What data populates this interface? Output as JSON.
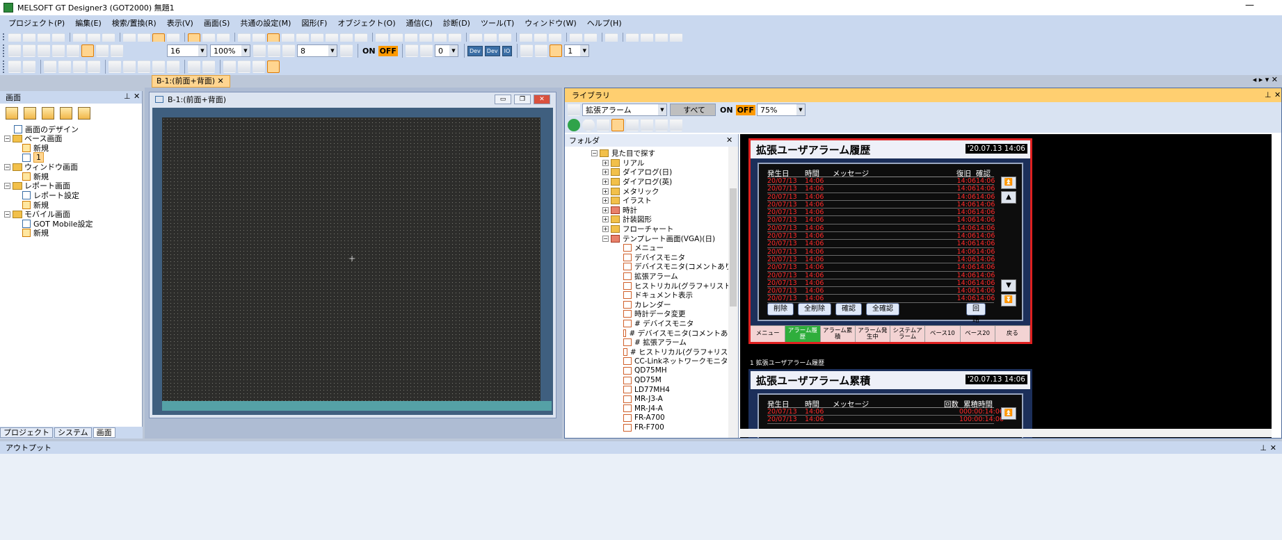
{
  "window": {
    "title": "MELSOFT GT Designer3 (GOT2000) 無題1"
  },
  "menu": [
    "プロジェクト(P)",
    "編集(E)",
    "検索/置換(R)",
    "表示(V)",
    "画面(S)",
    "共通の設定(M)",
    "図形(F)",
    "オブジェクト(O)",
    "通信(C)",
    "診断(D)",
    "ツール(T)",
    "ウィンドウ(W)",
    "ヘルプ(H)"
  ],
  "toolbar": {
    "font_size": "16",
    "zoom": "100%",
    "grid": "8",
    "on_label": "ON",
    "off_label": "OFF",
    "station": "0",
    "dev_label": "Dev",
    "io_label": "IO",
    "layer": "1"
  },
  "screen_panel": {
    "title": "画面",
    "tree": [
      {
        "label": "画面のデザイン",
        "level": 1,
        "kind": "item"
      },
      {
        "label": "ベース画面",
        "level": 0,
        "kind": "folder"
      },
      {
        "label": "新規",
        "level": 2,
        "kind": "new"
      },
      {
        "label": "1",
        "level": 2,
        "kind": "page-selected"
      },
      {
        "label": "ウィンドウ画面",
        "level": 0,
        "kind": "folder"
      },
      {
        "label": "新規",
        "level": 2,
        "kind": "new"
      },
      {
        "label": "レポート画面",
        "level": 0,
        "kind": "folder"
      },
      {
        "label": "レポート設定",
        "level": 2,
        "kind": "item"
      },
      {
        "label": "新規",
        "level": 2,
        "kind": "new"
      },
      {
        "label": "モバイル画面",
        "level": 0,
        "kind": "folder"
      },
      {
        "label": "GOT Mobile設定",
        "level": 2,
        "kind": "item"
      },
      {
        "label": "新規",
        "level": 2,
        "kind": "new"
      }
    ],
    "tabs": [
      "プロジェクト",
      "システム",
      "画面"
    ]
  },
  "editor": {
    "tab_label": "B-1:(前面+背面)",
    "window_title": "B-1:(前面+背面)"
  },
  "library": {
    "title": "ライブラリ",
    "category": "拡張アラーム",
    "filter": "すべて",
    "on_label": "ON",
    "off_label": "OFF",
    "zoom": "75%",
    "folder_header": "フォルダ",
    "folder_tree": [
      {
        "label": "見た目で探す",
        "level": 0,
        "kind": "folder-open"
      },
      {
        "label": "リアル",
        "level": 1,
        "kind": "folder"
      },
      {
        "label": "ダイアログ(日)",
        "level": 1,
        "kind": "folder"
      },
      {
        "label": "ダイアログ(英)",
        "level": 1,
        "kind": "folder"
      },
      {
        "label": "メタリック",
        "level": 1,
        "kind": "folder"
      },
      {
        "label": "イラスト",
        "level": 1,
        "kind": "folder"
      },
      {
        "label": "時計",
        "level": 1,
        "kind": "folder-red"
      },
      {
        "label": "計装図形",
        "level": 1,
        "kind": "folder"
      },
      {
        "label": "フローチャート",
        "level": 1,
        "kind": "folder"
      },
      {
        "label": "テンプレート画面(VGA)(日)",
        "level": 1,
        "kind": "folder-open-red"
      },
      {
        "label": "メニュー",
        "level": 2,
        "kind": "item"
      },
      {
        "label": "デバイスモニタ",
        "level": 2,
        "kind": "item"
      },
      {
        "label": "デバイスモニタ(コメントあり)",
        "level": 2,
        "kind": "item"
      },
      {
        "label": "拡張アラーム",
        "level": 2,
        "kind": "item"
      },
      {
        "label": "ヒストリカル(グラフ+リスト)",
        "level": 2,
        "kind": "item"
      },
      {
        "label": "ドキュメント表示",
        "level": 2,
        "kind": "item"
      },
      {
        "label": "カレンダー",
        "level": 2,
        "kind": "item"
      },
      {
        "label": "時計データ変更",
        "level": 2,
        "kind": "item"
      },
      {
        "label": "# デバイスモニタ",
        "level": 2,
        "kind": "item"
      },
      {
        "label": "# デバイスモニタ(コメントあり)",
        "level": 2,
        "kind": "item"
      },
      {
        "label": "# 拡張アラーム",
        "level": 2,
        "kind": "item"
      },
      {
        "label": "# ヒストリカル(グラフ+リスト)",
        "level": 2,
        "kind": "item"
      },
      {
        "label": "CC-Linkネットワークモニタ",
        "level": 2,
        "kind": "item"
      },
      {
        "label": "QD75MH",
        "level": 2,
        "kind": "item"
      },
      {
        "label": "QD75M",
        "level": 2,
        "kind": "item"
      },
      {
        "label": "LD77MH4",
        "level": 2,
        "kind": "item"
      },
      {
        "label": "MR-J3-A",
        "level": 2,
        "kind": "item"
      },
      {
        "label": "MR-J4-A",
        "level": 2,
        "kind": "item"
      },
      {
        "label": "FR-A700",
        "level": 2,
        "kind": "item"
      },
      {
        "label": "FR-F700",
        "level": 2,
        "kind": "item"
      }
    ]
  },
  "template1": {
    "title": "拡張ユーザアラーム履歴",
    "clock": "'20.07.13 14:06",
    "headers": {
      "date": "発生日",
      "time": "時間",
      "msg": "メッセージ",
      "recover": "復旧",
      "ack": "確認"
    },
    "rows": [
      [
        "20/07/13",
        "14:06",
        "",
        "14:06",
        "14:06"
      ],
      [
        "20/07/13",
        "14:06",
        "",
        "14:06",
        "14:06"
      ],
      [
        "20/07/13",
        "14:06",
        "",
        "14:06",
        "14:06"
      ],
      [
        "20/07/13",
        "14:06",
        "",
        "14:06",
        "14:06"
      ],
      [
        "20/07/13",
        "14:06",
        "",
        "14:06",
        "14:06"
      ],
      [
        "20/07/13",
        "14:06",
        "",
        "14:06",
        "14:06"
      ],
      [
        "20/07/13",
        "14:06",
        "",
        "14:06",
        "14:06"
      ],
      [
        "20/07/13",
        "14:06",
        "",
        "14:06",
        "14:06"
      ],
      [
        "20/07/13",
        "14:06",
        "",
        "14:06",
        "14:06"
      ],
      [
        "20/07/13",
        "14:06",
        "",
        "14:06",
        "14:06"
      ],
      [
        "20/07/13",
        "14:06",
        "",
        "14:06",
        "14:06"
      ],
      [
        "20/07/13",
        "14:06",
        "",
        "14:06",
        "14:06"
      ],
      [
        "20/07/13",
        "14:06",
        "",
        "14:06",
        "14:06"
      ],
      [
        "20/07/13",
        "14:06",
        "",
        "14:06",
        "14:06"
      ],
      [
        "20/07/13",
        "14:06",
        "",
        "14:06",
        "14:06"
      ],
      [
        "20/07/13",
        "14:06",
        "",
        "14:06",
        "14:06"
      ]
    ],
    "buttons": [
      "削除",
      "全削除",
      "確認",
      "全確認"
    ],
    "restore_button": "回路",
    "nav": [
      "メニュー",
      "アラーム履歴",
      "アラーム累積",
      "アラーム発生中",
      "システムアラーム",
      "ベース10",
      "ベース20",
      "戻る"
    ],
    "active_nav": 1,
    "caption": "1 拡張ユーザアラーム履歴"
  },
  "template2": {
    "title": "拡張ユーザアラーム累積",
    "clock": "'20.07.13 14:06",
    "headers": {
      "date": "発生日",
      "time": "時間",
      "msg": "メッセージ",
      "count": "回数",
      "total": "累積時間"
    },
    "rows": [
      [
        "20/07/13",
        "14:06",
        "",
        "0",
        "00:00:14:06"
      ],
      [
        "20/07/13",
        "14:06",
        "",
        "1",
        "00:00:14:06"
      ]
    ]
  },
  "output": {
    "title": "アウトプット"
  }
}
